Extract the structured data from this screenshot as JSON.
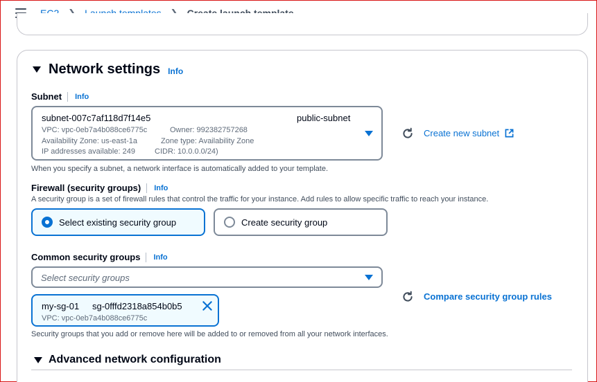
{
  "breadcrumb": {
    "items": [
      "EC2",
      "Launch templates"
    ],
    "current": "Create launch template"
  },
  "network": {
    "title": "Network settings",
    "info": "Info",
    "subnet": {
      "label": "Subnet",
      "info": "Info",
      "id": "subnet-007c7af118d7f14e5",
      "name": "public-subnet",
      "vpc": "VPC: vpc-0eb7a4b088ce6775c",
      "owner": "Owner: 992382757268",
      "az": "Availability Zone: us-east-1a",
      "zone_type": "Zone type: Availability Zone",
      "ips": "IP addresses available: 249",
      "cidr": "CIDR: 10.0.0.0/24)",
      "create_link": "Create new subnet",
      "description": "When you specify a subnet, a network interface is automatically added to your template."
    },
    "firewall": {
      "label": "Firewall (security groups)",
      "info": "Info",
      "description": "A security group is a set of firewall rules that control the traffic for your instance. Add rules to allow specific traffic to reach your instance.",
      "option_existing": "Select existing security group",
      "option_create": "Create security group",
      "selected": "Select existing security group"
    },
    "common_sg": {
      "label": "Common security groups",
      "info": "Info",
      "placeholder": "Select security groups",
      "compare_link": "Compare security group rules",
      "token_name": "my-sg-01",
      "token_id": "sg-0fffd2318a854b0b5",
      "token_vpc": "VPC: vpc-0eb7a4b088ce6775c",
      "description": "Security groups that you add or remove here will be added to or removed from all your network interfaces."
    },
    "advanced": {
      "title": "Advanced network configuration"
    }
  },
  "colors": {
    "link": "#0972d3",
    "text": "#000716",
    "muted": "#5f6b7a",
    "border": "#7d8998",
    "selected_bg": "#f0fbff"
  }
}
